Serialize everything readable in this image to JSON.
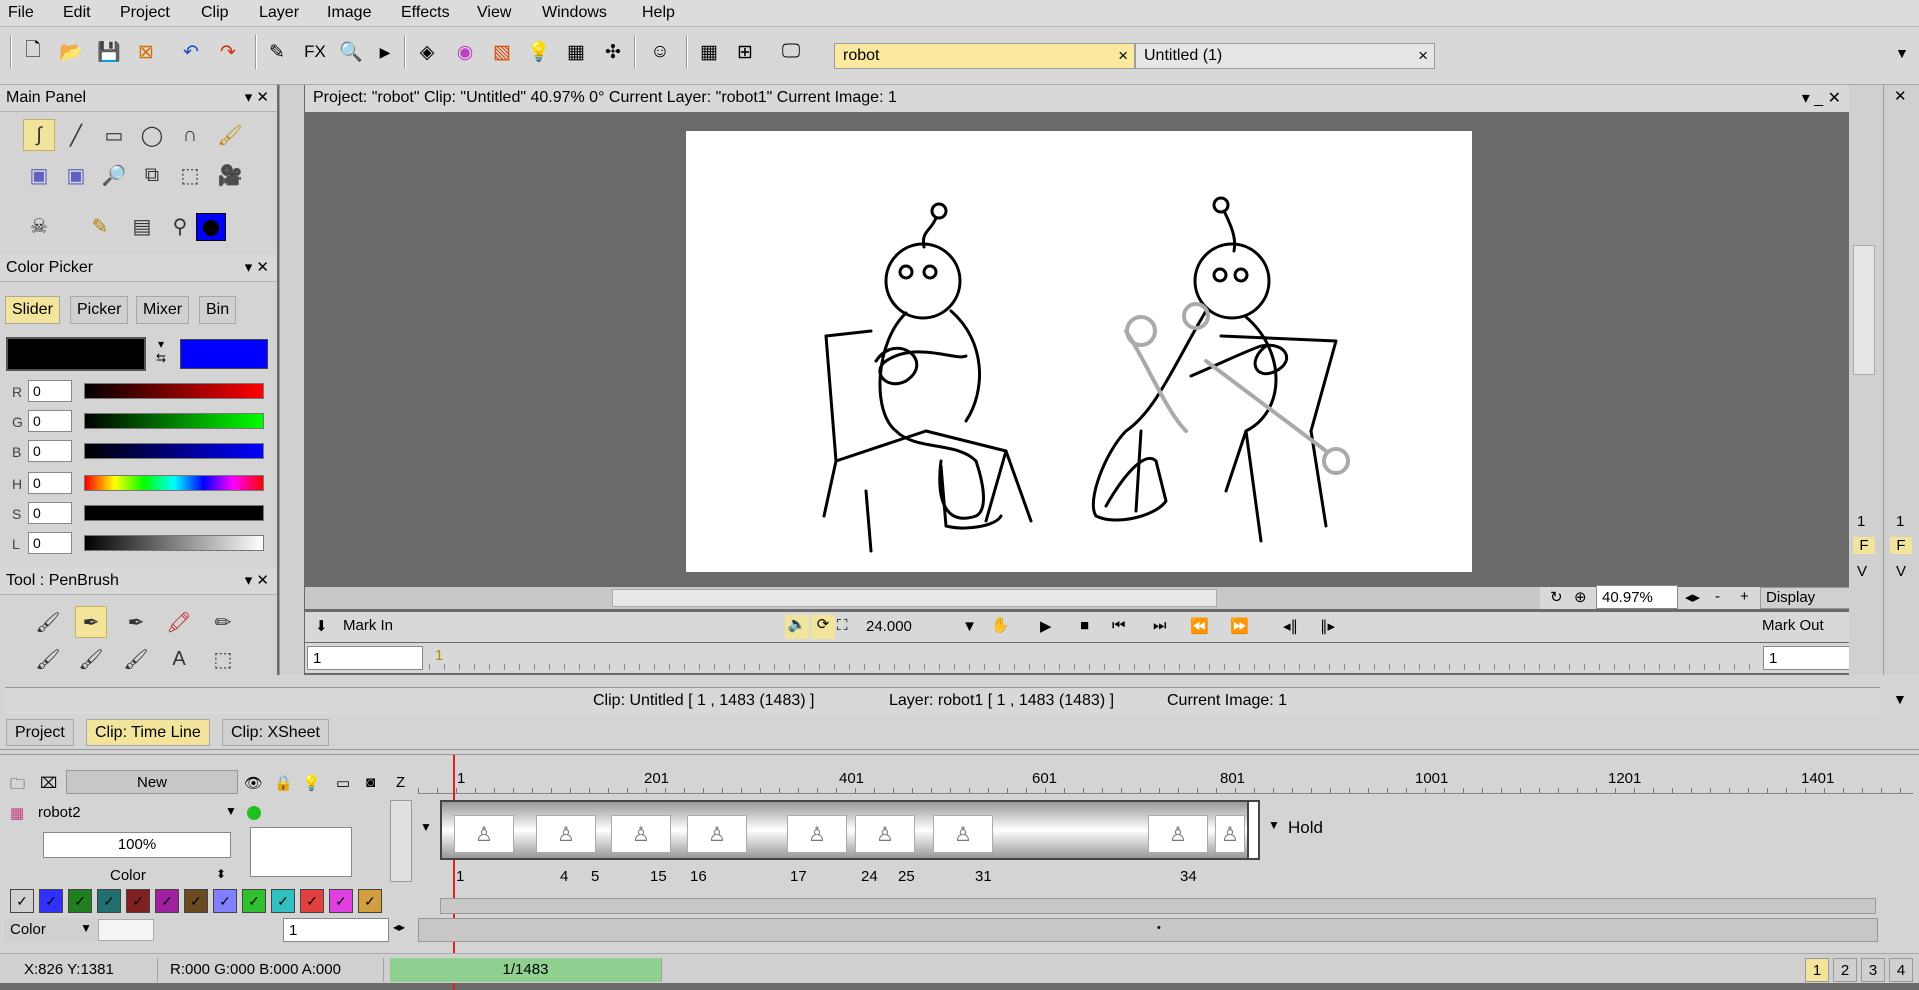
{
  "menu": [
    "File",
    "Edit",
    "Project",
    "Clip",
    "Layer",
    "Image",
    "Effects",
    "View",
    "Windows",
    "Help"
  ],
  "toolbar": {
    "fx_label": "FX",
    "tabs": [
      {
        "label": "robot"
      },
      {
        "label": "Untitled (1)"
      }
    ],
    "close_glyph": "×",
    "dropdown_glyph": "▼"
  },
  "left": {
    "main_panel_title": "Main Panel",
    "color_picker_title": "Color Picker",
    "color_tabs": [
      "Slider",
      "Picker",
      "Mixer",
      "Bin"
    ],
    "channels": [
      {
        "label": "R",
        "value": "0"
      },
      {
        "label": "G",
        "value": "0"
      },
      {
        "label": "B",
        "value": "0"
      },
      {
        "label": "H",
        "value": "0"
      },
      {
        "label": "S",
        "value": "0"
      },
      {
        "label": "L",
        "value": "0"
      }
    ],
    "tool_title": "Tool : PenBrush",
    "primary_color": "#000000",
    "secondary_color": "#0000ff"
  },
  "viewer": {
    "info": "Project:  \"robot\"  Clip: \"Untitled\"   40.97%   0°   Current Layer: \"robot1\"   Current Image: 1",
    "zoom": "40.97%",
    "zoom_minus": "-",
    "zoom_plus": "+",
    "display": "Display",
    "mark_in": "Mark In",
    "mark_out": "Mark Out",
    "fps": "24.000",
    "mark_in_value": "1",
    "mark_out_value": "1",
    "ruler_start": "1",
    "side_labels": [
      "1",
      "F",
      "V"
    ]
  },
  "bottom": {
    "clip_info": "Clip: Untitled [ 1 , 1483  (1483) ]",
    "layer_info": "Layer: robot1 [ 1 , 1483  (1483) ]",
    "current_image": "Current Image: 1",
    "tabs": [
      "Project",
      "Clip: Time Line",
      "Clip: XSheet"
    ],
    "new_label": "New",
    "z_label": "Z",
    "layer_name": "robot2",
    "opacity": "100%",
    "color_label": "Color",
    "color_dropdown": "Color",
    "frame_value": "1",
    "hold_label": "Hold",
    "ruler": [
      "1",
      "201",
      "401",
      "601",
      "801",
      "1001",
      "1201",
      "1401"
    ],
    "frame_numbers": [
      "1",
      "4",
      "5",
      "15",
      "16",
      "17",
      "24",
      "25",
      "31",
      "34"
    ],
    "swatch_colors": [
      "#d0d0d0",
      "#3030ff",
      "#208020",
      "#207070",
      "#802020",
      "#a020a0",
      "#6a4a20",
      "#8080ff",
      "#30c030",
      "#30c0c0",
      "#e04040",
      "#e040e0",
      "#d0a040"
    ],
    "check_glyph": "✓"
  },
  "status": {
    "coords": "X:826  Y:1381",
    "rgba": "R:000 G:000 B:000 A:000",
    "frame": "1/1483",
    "views": [
      "1",
      "2",
      "3",
      "4"
    ]
  }
}
